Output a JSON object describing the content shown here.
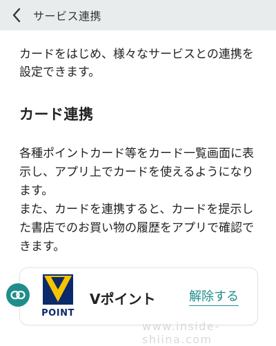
{
  "header": {
    "title": "サービス連携",
    "back_icon": "chevron-left-icon"
  },
  "intro": {
    "text": "カードをはじめ、様々なサービスとの連携を設定できます。"
  },
  "section": {
    "title": "カード連携",
    "description_1": "各種ポイントカード等をカード一覧画面に表示し、アプリ上でカードを使えるようになります。",
    "description_2": "また、カードを連携すると、カードを提示した書店でのお買い物の履歴をアプリで確認できます。"
  },
  "card_item": {
    "link_icon": "link-icon",
    "logo_text": "POINT",
    "name": "Vポイント",
    "action_label": "解除する"
  },
  "watermark": "www.inside-shiina.com",
  "colors": {
    "header_bg": "#e9ecec",
    "accent": "#1f8d8a",
    "logo_yellow": "#f7c500",
    "logo_navy": "#0b2a6b"
  }
}
